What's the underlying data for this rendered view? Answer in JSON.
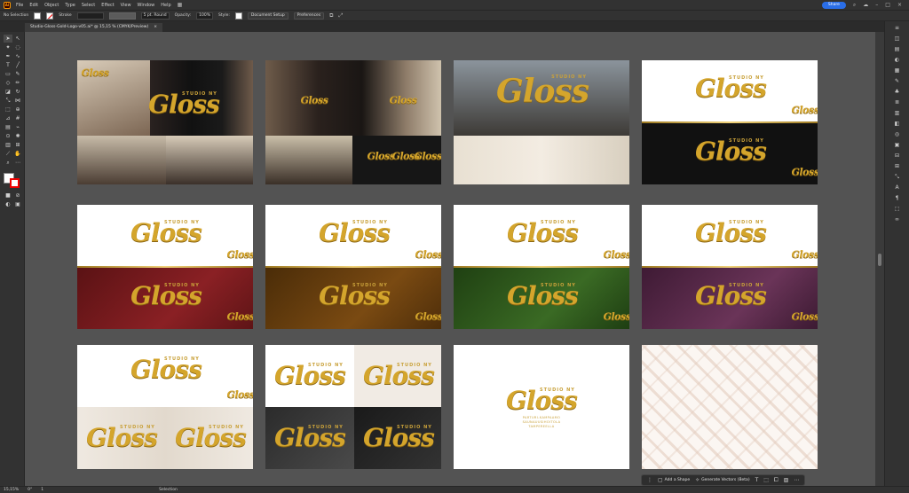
{
  "menubar": {
    "app_logo": "Ai",
    "items": [
      "File",
      "Edit",
      "Object",
      "Type",
      "Select",
      "Effect",
      "View",
      "Window",
      "Help"
    ],
    "share_label": "Share"
  },
  "controlbar": {
    "selection_label": "No Selection",
    "stroke_label": "Stroke",
    "brush_value": "5 pt. Round",
    "opacity_label": "Opacity:",
    "opacity_value": "100%",
    "style_label": "Style:",
    "document_setup_label": "Document Setup",
    "preferences_label": "Preferences"
  },
  "document": {
    "tab_title": "Studio-Gloss-Gold-Logo-v05.ai* @ 15,15 % (CMYK/Preview)",
    "close_glyph": "×"
  },
  "logo": {
    "studio_text": "STUDIO NY",
    "gloss_text": "Gloss",
    "tagline_lines": [
      "PARTURI-KAMPAAMO",
      "SAUNAUUSIHOITOLA",
      "TAMPEREELLA"
    ]
  },
  "colors": {
    "gold": "#d4a52c",
    "burgundy": "#7a1a1e",
    "brown": "#6a3f0c",
    "green": "#2f5a1e",
    "plum": "#5a2a4a",
    "canvas": "#535353"
  },
  "icons": {
    "tools": [
      "selection-icon",
      "direct-selection-icon",
      "magic-wand-icon",
      "lasso-icon",
      "pen-icon",
      "curvature-icon",
      "type-icon",
      "line-icon",
      "rectangle-icon",
      "paintbrush-icon",
      "shaper-icon",
      "pencil-icon",
      "eraser-icon",
      "rotate-icon",
      "scale-icon",
      "width-icon",
      "free-transform-icon",
      "shape-builder-icon",
      "perspective-icon",
      "mesh-icon",
      "gradient-icon",
      "eyedropper-icon",
      "blend-icon",
      "symbol-sprayer-icon",
      "graph-icon",
      "artboard-icon",
      "slice-icon",
      "hand-icon",
      "zoom-icon",
      "more-tools-icon"
    ]
  },
  "statusbar": {
    "zoom": "15,15%",
    "rotation": "0°",
    "artboard_nav": "1",
    "tool_name": "Selection"
  },
  "taskbar": {
    "add_shape_label": "Add a Shape",
    "generate_vectors_label": "Generate Vectors (Beta)"
  }
}
